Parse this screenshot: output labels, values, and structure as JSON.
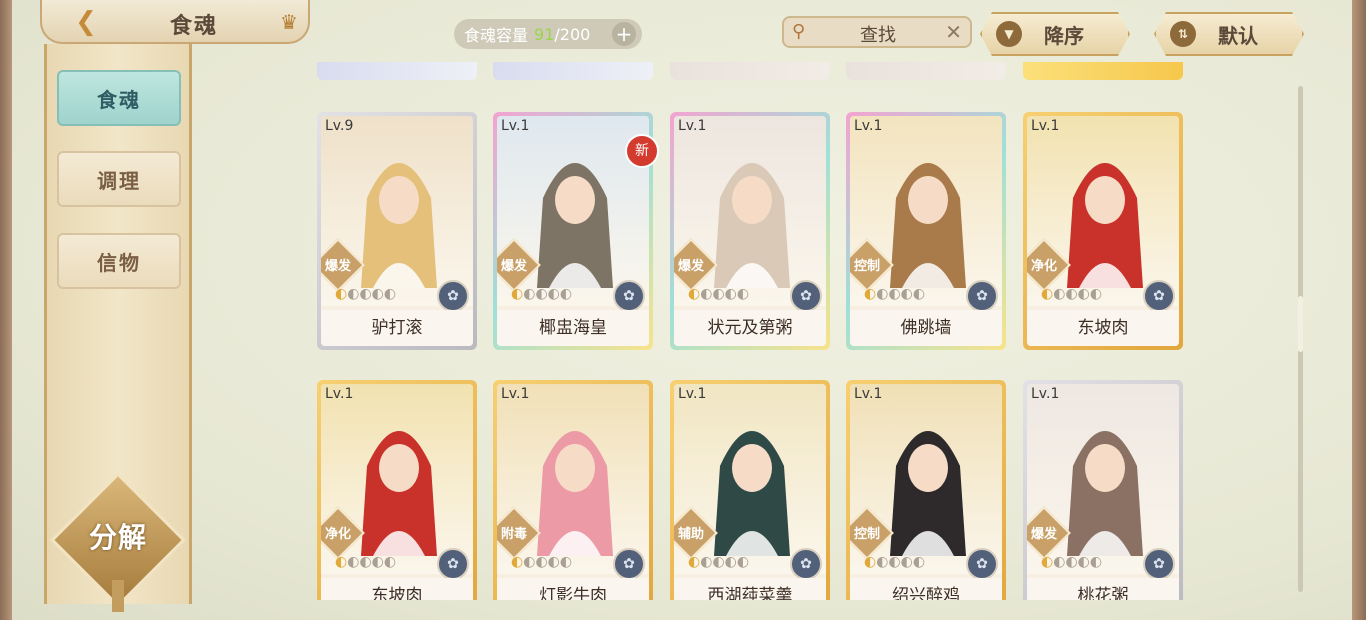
{
  "header": {
    "title": "食魂",
    "capacity_label": "食魂容量",
    "capacity_current": "91",
    "capacity_max": "/200",
    "search_label": "查找",
    "sort_desc_label": "降序",
    "sort_default_label": "默认"
  },
  "sidebar": {
    "items": [
      {
        "label": "食魂",
        "active": true
      },
      {
        "label": "调理",
        "active": false
      },
      {
        "label": "信物",
        "active": false
      }
    ],
    "decompose_label": "分解"
  },
  "cards": [
    {
      "level": "Lv.9",
      "name": "驴打滚",
      "role": "爆发",
      "frame": "silver",
      "portrait_color": "#efe1c9",
      "hair": "#e4c07a",
      "new": false,
      "stars_lit": 1
    },
    {
      "level": "Lv.1",
      "name": "椰盅海皇",
      "role": "爆发",
      "frame": "rainbow",
      "portrait_color": "#dfe8ef",
      "hair": "#7d7465",
      "new": true,
      "new_label": "新",
      "stars_lit": 1
    },
    {
      "level": "Lv.1",
      "name": "状元及第粥",
      "role": "爆发",
      "frame": "rainbow",
      "portrait_color": "#ede6df",
      "hair": "#d9c9b6",
      "new": false,
      "stars_lit": 1
    },
    {
      "level": "Lv.1",
      "name": "佛跳墙",
      "role": "控制",
      "frame": "rainbow",
      "portrait_color": "#f3e4bf",
      "hair": "#a97b4a",
      "new": false,
      "stars_lit": 1
    },
    {
      "level": "Lv.1",
      "name": "东坡肉",
      "role": "净化",
      "frame": "gold",
      "portrait_color": "#f2e2b0",
      "hair": "#c8322a",
      "new": false,
      "stars_lit": 1
    },
    {
      "level": "Lv.1",
      "name": "东坡肉",
      "role": "净化",
      "frame": "gold",
      "portrait_color": "#f2e2b0",
      "hair": "#c8322a",
      "new": false,
      "stars_lit": 1
    },
    {
      "level": "Lv.1",
      "name": "灯影牛肉",
      "role": "附毒",
      "frame": "gold",
      "portrait_color": "#f1e0b7",
      "hair": "#ec9aa5",
      "new": false,
      "stars_lit": 1
    },
    {
      "level": "Lv.1",
      "name": "西湖莼菜羹",
      "role": "辅助",
      "frame": "gold",
      "portrait_color": "#f1e6c2",
      "hair": "#2f4a46",
      "new": false,
      "stars_lit": 1
    },
    {
      "level": "Lv.1",
      "name": "绍兴醉鸡",
      "role": "控制",
      "frame": "gold",
      "portrait_color": "#f0e0b6",
      "hair": "#2e2a2b",
      "new": false,
      "stars_lit": 1
    },
    {
      "level": "Lv.1",
      "name": "桃花粥",
      "role": "爆发",
      "frame": "silver",
      "portrait_color": "#eee7e2",
      "hair": "#8a7164",
      "new": false,
      "stars_lit": 1
    }
  ],
  "colors": {
    "frame_gold": "#e8b64e",
    "frame_silver": "#c9c9cc",
    "frame_rainbow_a": "#f3a3d1",
    "frame_rainbow_b": "#9fe0d8",
    "frame_rainbow_c": "#f8e38a"
  }
}
